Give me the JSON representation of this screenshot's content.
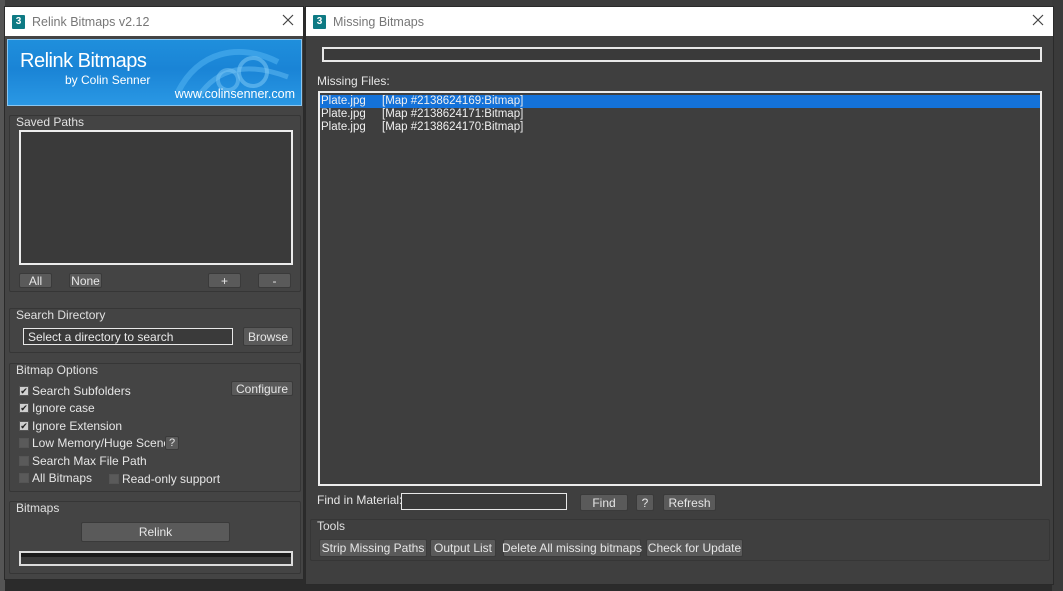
{
  "relink_window": {
    "title": "Relink Bitmaps v2.12",
    "app_icon": "3",
    "banner": {
      "title": "Relink Bitmaps",
      "byline": "by Colin Senner",
      "url": "www.colinsenner.com"
    },
    "saved_paths": {
      "label": "Saved Paths",
      "buttons": {
        "all": "All",
        "none": "None",
        "add": "+",
        "remove": "-"
      }
    },
    "search_directory": {
      "label": "Search Directory",
      "field_value": "Select a directory to search",
      "browse": "Browse"
    },
    "bitmap_options": {
      "label": "Bitmap Options",
      "configure": "Configure",
      "help": "?",
      "options": [
        {
          "label": "Search Subfolders",
          "checked": true
        },
        {
          "label": "Ignore case",
          "checked": true
        },
        {
          "label": "Ignore Extension",
          "checked": true
        },
        {
          "label": "Low Memory/Huge Scene",
          "checked": false
        },
        {
          "label": "Search Max File Path",
          "checked": false
        },
        {
          "label": "All Bitmaps",
          "checked": false
        },
        {
          "label": "Read-only support",
          "checked": false
        }
      ]
    },
    "bitmaps": {
      "label": "Bitmaps",
      "relink": "Relink"
    }
  },
  "missing_window": {
    "title": "Missing Bitmaps",
    "app_icon": "3",
    "missing_files_label": "Missing Files:",
    "files": [
      {
        "name": "Plate.jpg",
        "map": "[Map #2138624169:Bitmap]",
        "selected": true
      },
      {
        "name": "Plate.jpg",
        "map": "[Map #2138624171:Bitmap]",
        "selected": false
      },
      {
        "name": "Plate.jpg",
        "map": "[Map #2138624170:Bitmap]",
        "selected": false
      }
    ],
    "find_in_material_label": "Find in Material:",
    "find_in_material_value": "",
    "find": "Find",
    "help": "?",
    "refresh": "Refresh",
    "tools": {
      "label": "Tools",
      "strip_missing_paths": "Strip Missing Paths",
      "output_list": "Output List",
      "delete_all": "Delete All missing bitmaps",
      "check_update": "Check for Update"
    }
  },
  "colors": {
    "selection": "#1472d9",
    "banner": "#1a84d6",
    "app_icon": "#0e7a84"
  }
}
